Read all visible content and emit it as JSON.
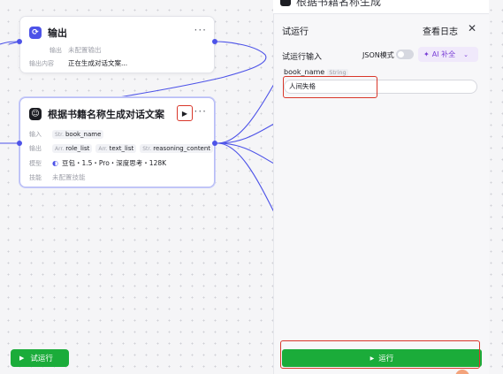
{
  "output_node": {
    "title": "输出",
    "output_label": "输出",
    "output_value": "未配置输出",
    "content_label": "输出内容",
    "content_value": "正在生成对话文案..."
  },
  "llm_node": {
    "title": "根据书籍名称生成对话文案",
    "input_label": "输入",
    "input_tag_prefix": "Str.",
    "input_tag": "book_name",
    "output_label": "输出",
    "outputs": [
      {
        "prefix": "Arr.",
        "name": "role_list"
      },
      {
        "prefix": "Arr.",
        "name": "text_list"
      },
      {
        "prefix": "Str.",
        "name": "reasoning_content"
      }
    ],
    "model_label": "模型",
    "model_value": "豆包・1.5・Pro・深度思考・128K",
    "skills_label": "技能",
    "skills_value": "未配置技能"
  },
  "panel": {
    "top_title_cut": "根据书籍名称生成",
    "title": "试运行",
    "log_button": "查看日志",
    "close_icon": "close-icon",
    "input_section": "试运行输入",
    "json_mode_label": "JSON模式",
    "ai_button": "AI 补全",
    "field_name": "book_name",
    "field_type": "String",
    "field_value": "人间失格",
    "run_button": "运行"
  },
  "canvas": {
    "test_run_button": "试运行"
  },
  "colors": {
    "accent": "#4d53e8",
    "run_green": "#1bac3a",
    "highlight_red": "#d9372a",
    "ai_purple": "#7a3fd6"
  }
}
